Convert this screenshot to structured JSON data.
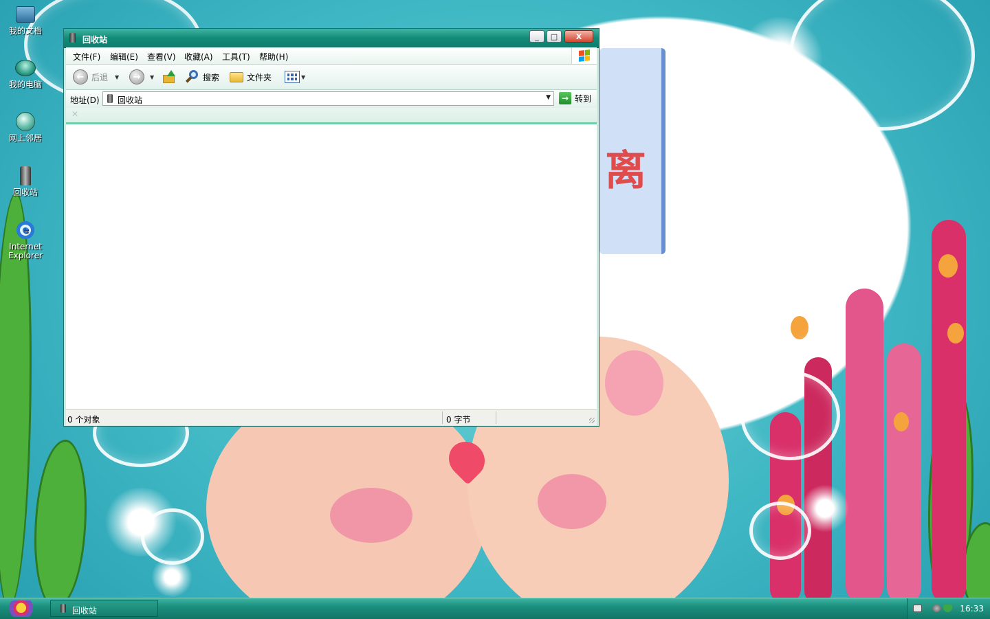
{
  "desktop": {
    "icons": [
      {
        "label": "我的文档"
      },
      {
        "label": "我的电脑"
      },
      {
        "label": "网上邻居"
      },
      {
        "label": "回收站"
      },
      {
        "label_line1": "Internet",
        "label_line2": "Explorer"
      }
    ],
    "wallpaper_text": "离"
  },
  "window": {
    "title": "回收站",
    "controls": {
      "minimize": "_",
      "maximize": "□",
      "close": "X"
    },
    "menu": [
      "文件(F)",
      "编辑(E)",
      "查看(V)",
      "收藏(A)",
      "工具(T)",
      "帮助(H)"
    ],
    "toolbar": {
      "back_label": "后退",
      "back_glyph": "←",
      "forward_glyph": "→",
      "dropdown_glyph": "▼",
      "search_label": "搜索",
      "folders_label": "文件夹"
    },
    "address": {
      "label": "地址(D)",
      "value": "回收站",
      "dropdown_glyph": "▼",
      "go_label": "转到",
      "go_glyph": "→"
    },
    "linksbar": {
      "close_glyph": "✕"
    },
    "status": {
      "objects": "0 个对象",
      "size": "0 字节"
    }
  },
  "taskbar": {
    "item_label": "回收站",
    "clock": "16:33"
  },
  "colors": {
    "titlebar": "#138b79",
    "accent_green": "#6fcfa9",
    "wallpaper_teal": "#3fb7c4"
  }
}
